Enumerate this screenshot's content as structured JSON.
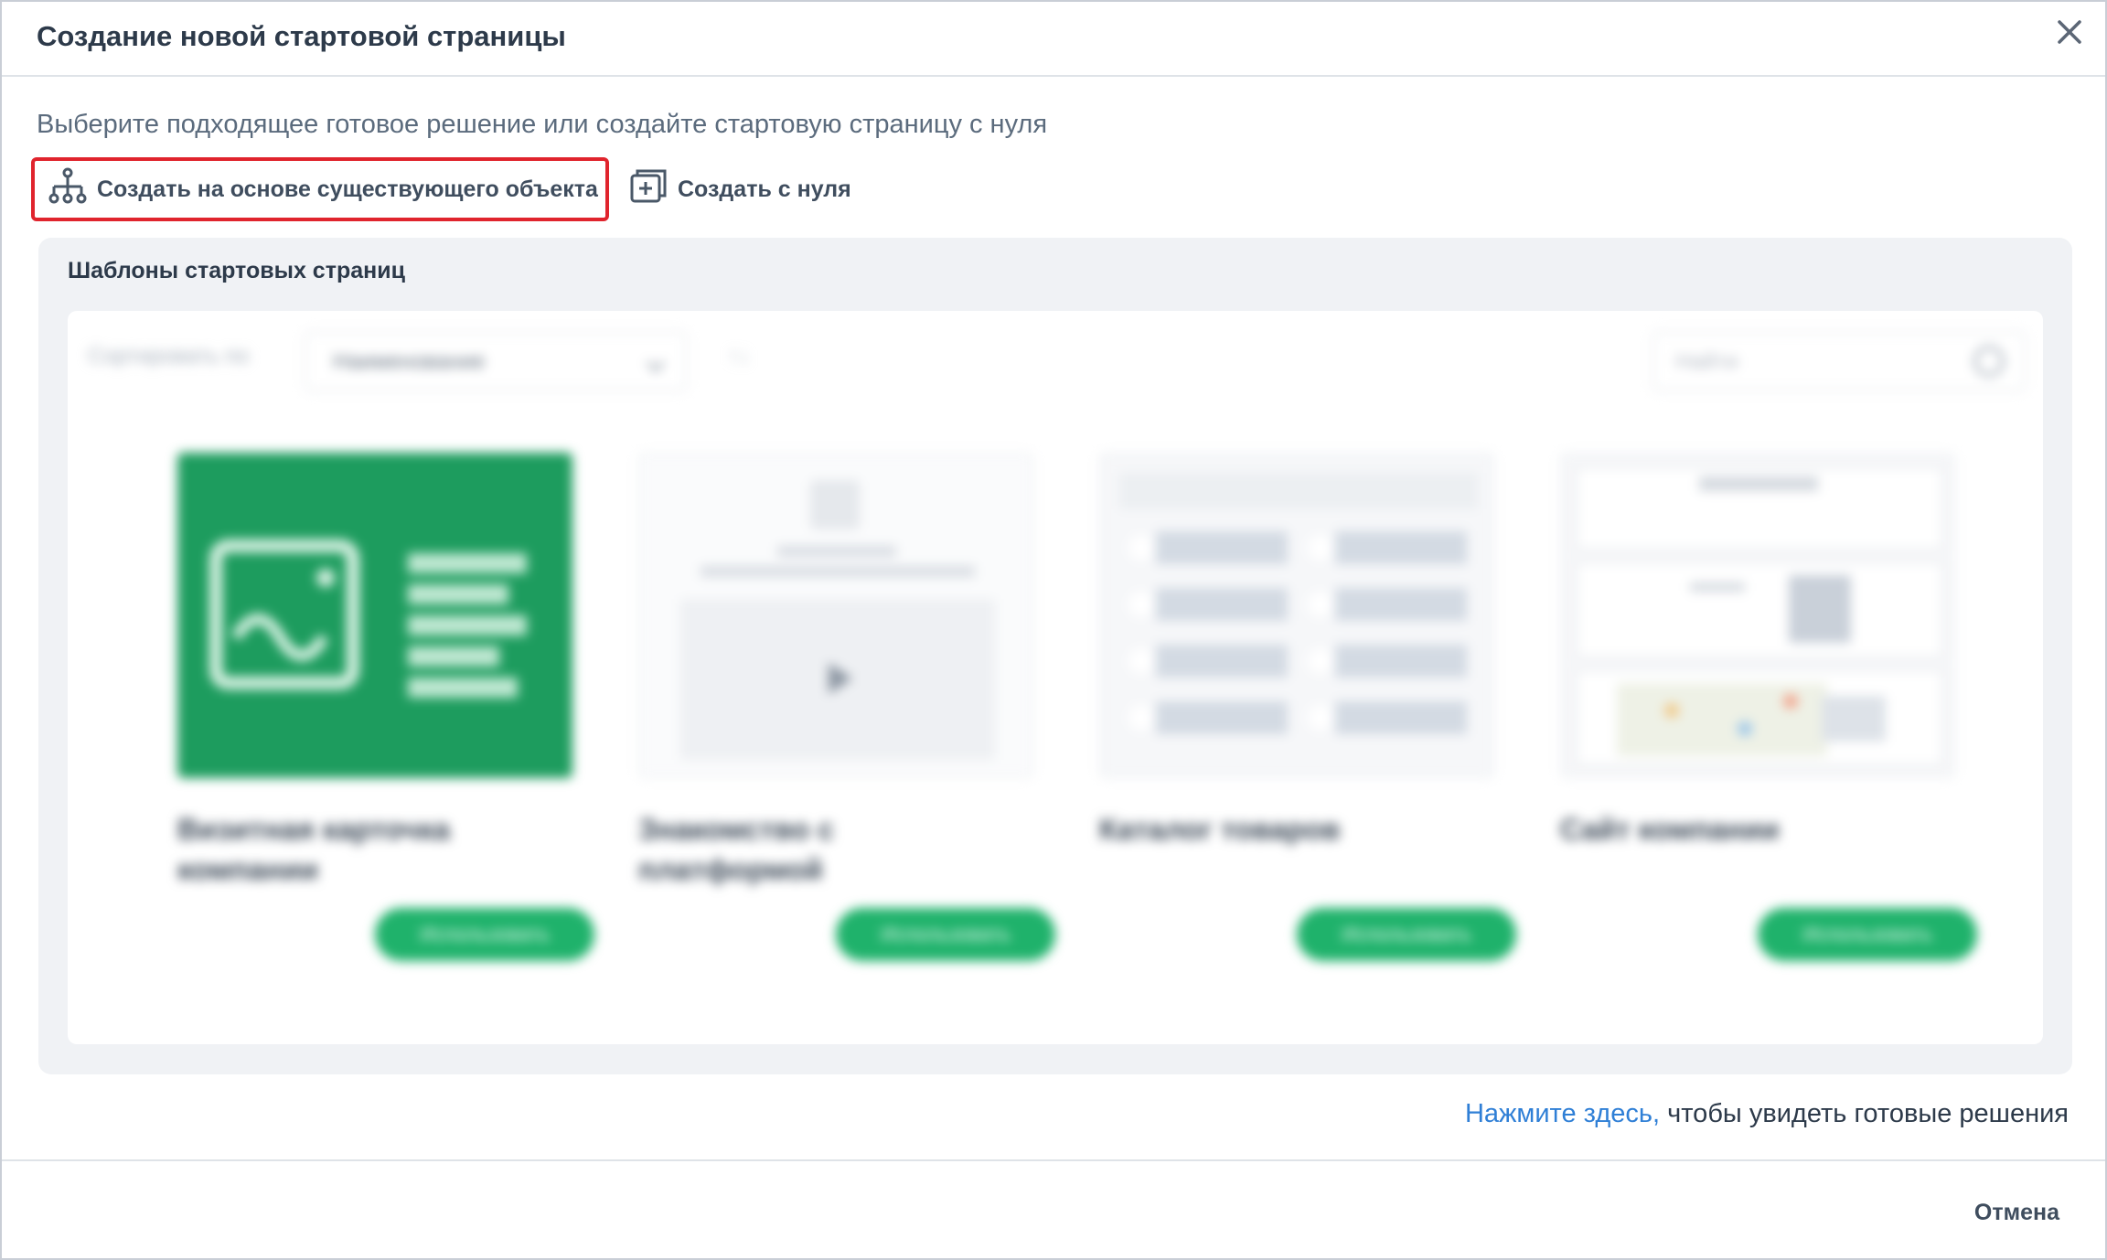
{
  "dialog": {
    "title": "Создание новой стартовой страницы",
    "subtitle": "Выберите подходящее готовое решение или создайте стартовую страницу с нуля",
    "close_icon": "close-icon"
  },
  "modes": {
    "existing_label": "Создать на основе существующего объекта",
    "existing_icon": "hierarchy-icon",
    "scratch_label": "Создать с нуля",
    "scratch_icon": "add-page-icon",
    "highlight_color": "#e0242d"
  },
  "templates": {
    "title": "Шаблоны стартовых страниц",
    "sort_label": "Сортировать по",
    "sort_value": "Наименование",
    "search_placeholder": "Найти",
    "cards": [
      {
        "name": "Визитная карточка компании",
        "button": "Использовать"
      },
      {
        "name": "Знакомство с платформой",
        "button": "Использовать"
      },
      {
        "name": "Каталог товаров",
        "button": "Использовать"
      },
      {
        "name": "Сайт компании",
        "button": "Использовать"
      }
    ]
  },
  "footer": {
    "link_text": "Нажмите здесь,",
    "note_text": " чтобы увидеть готовые решения",
    "cancel_label": "Отмена"
  },
  "colors": {
    "accent_green": "#1fb26b",
    "link_blue": "#2f7fd6"
  }
}
